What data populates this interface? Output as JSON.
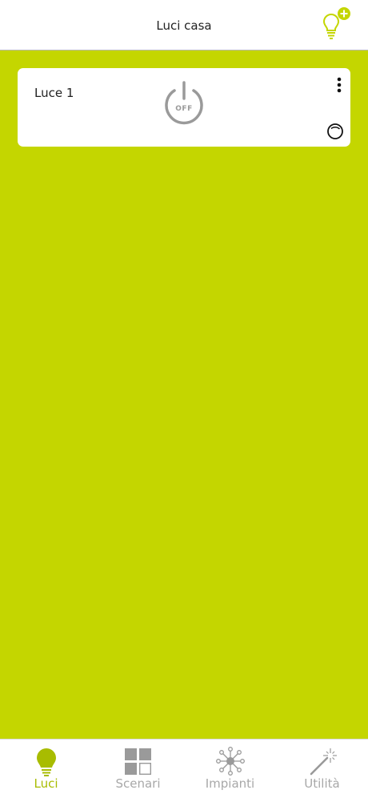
{
  "header": {
    "title": "Luci casa",
    "add_icon": "add-light-bulb-icon"
  },
  "lights": [
    {
      "name": "Luce 1",
      "state_label": "OFF",
      "power_icon": "power-icon",
      "menu_icon": "more-vertical-icon",
      "status_icon": "circle-status-icon"
    }
  ],
  "tabs": [
    {
      "label": "Luci",
      "icon": "bulb-icon",
      "active": true
    },
    {
      "label": "Scenari",
      "icon": "grid-icon",
      "active": false
    },
    {
      "label": "Impianti",
      "icon": "network-icon",
      "active": false
    },
    {
      "label": "Utilità",
      "icon": "magic-wand-icon",
      "active": false
    }
  ],
  "colors": {
    "accent": "#c4d600",
    "active_tab": "#a8bc00",
    "inactive": "#a8a8a8",
    "power_gray": "#9a9a9a"
  }
}
